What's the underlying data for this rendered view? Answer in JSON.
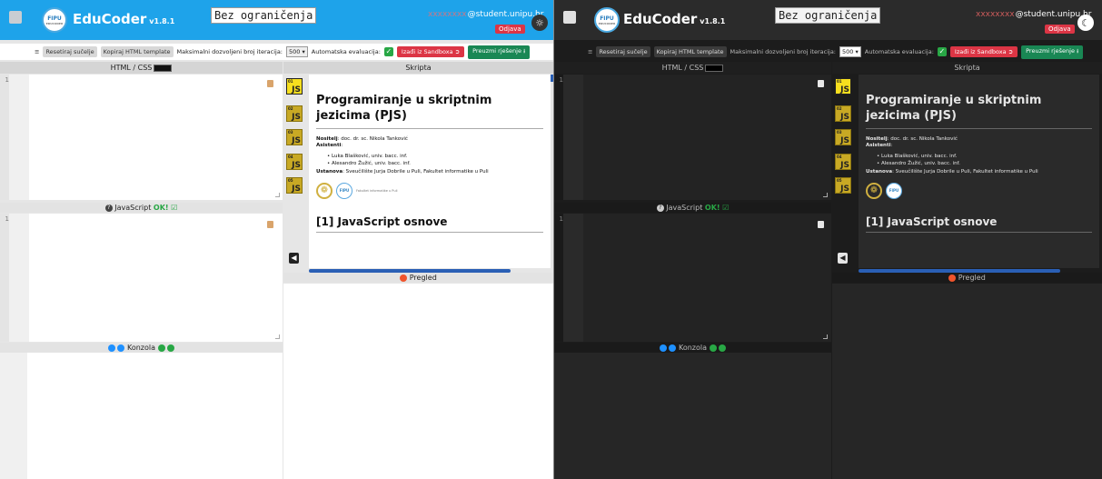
{
  "app": {
    "name": "EduCoder",
    "version": "v1.8.1",
    "logo_text": "FIPU",
    "mode": "Bez ograničenja",
    "user_hidden": "xxxxxxxx",
    "user_email": "@student.unipu.hr",
    "logout_label": "Odjava",
    "light_theme_icon": "sun-icon",
    "dark_theme_icon": "moon-icon"
  },
  "toolbar": {
    "settings_icon": "sliders-icon",
    "reset_label": "Resetiraj sučelje",
    "copy_label": "Kopiraj HTML template",
    "max_iter_label": "Maksimalni dozvoljeni broj iteracija:",
    "max_iter_value": "500",
    "auto_eval_label": "Automatska evaluacija:",
    "exit_label": "Izađi iz Sandboxa",
    "download_label": "Preuzmi rješenje"
  },
  "panels": {
    "html_css": "HTML / CSS",
    "script": "Skripta",
    "javascript": "JavaScript",
    "ok": "OK!",
    "console": "Konzola",
    "preview": "Pregled",
    "line1": "1"
  },
  "doc": {
    "title": "Programiranje u skriptnim jezicima (PJS)",
    "holder_label": "Nositelj",
    "holder_value": ": doc. dr. sc. Nikola Tanković",
    "assistants_label": "Asistenti",
    "assistants": [
      "Luka Blašković, univ. bacc. inf.",
      "Alesandro Žužić, univ. bacc. inf."
    ],
    "institution_label": "Ustanova",
    "institution_value": ": Sveučilište Jurja Dobrile u Puli, Fakultet informatike u Puli",
    "faculty_text": "Fakultet informatike u Puli",
    "logo_text": "FIPU",
    "section_title": "[1] JavaScript osnove"
  },
  "js_tiles": {
    "label": "JS",
    "numbers": [
      "01",
      "02",
      "03",
      "04",
      "05"
    ]
  },
  "colors": {
    "header_light": "#1ea3ea",
    "header_dark": "#2b2b2b",
    "danger": "#dc3545",
    "success": "#198754",
    "js_yellow": "#f7df1e"
  }
}
